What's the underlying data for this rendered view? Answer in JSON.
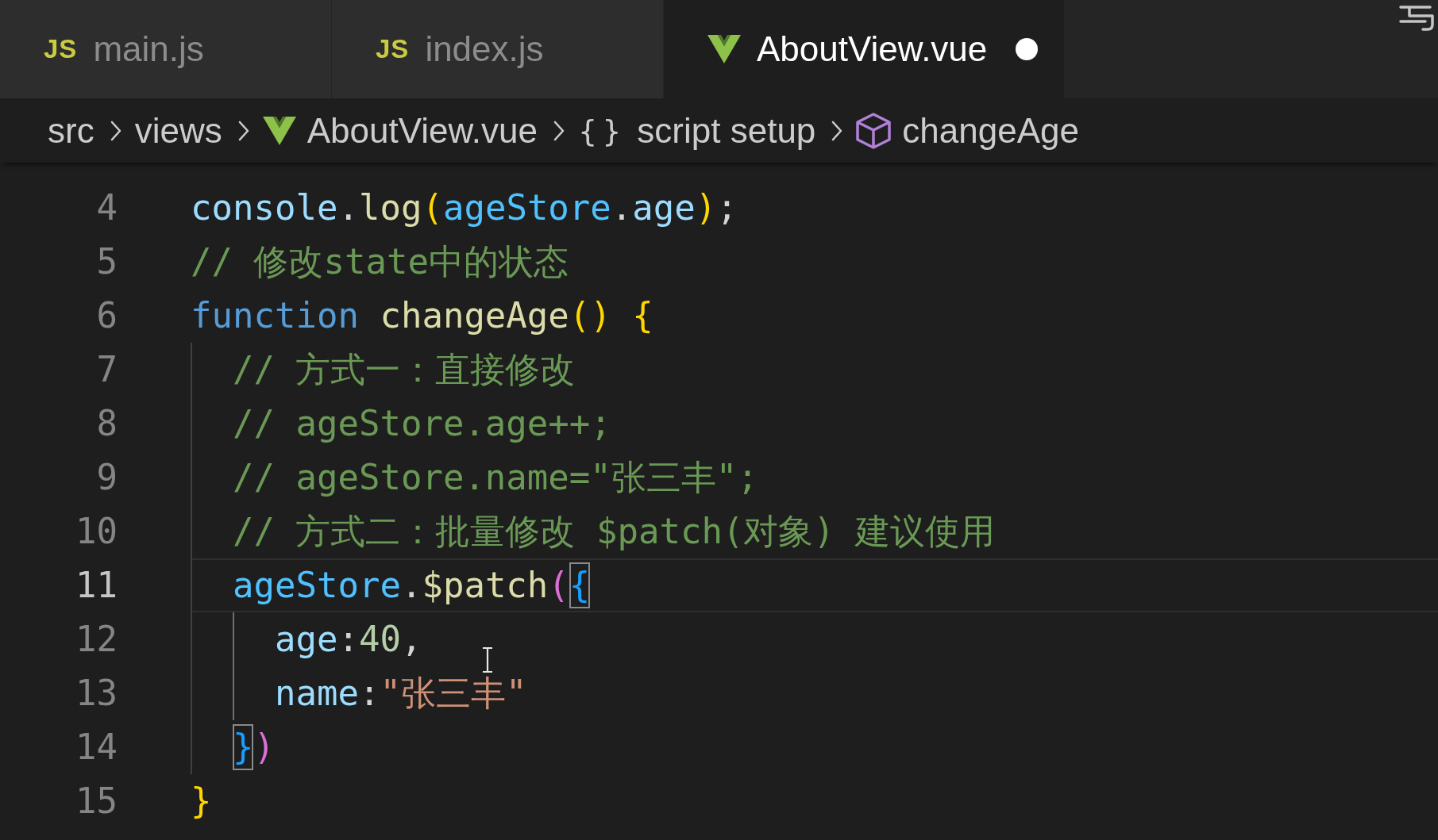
{
  "tabs": [
    {
      "kind": "js",
      "badge": "JS",
      "label": "main.js",
      "selected": false,
      "modified": false
    },
    {
      "kind": "js",
      "badge": "JS",
      "label": "index.js",
      "selected": false,
      "modified": false
    },
    {
      "kind": "vue",
      "label": "AboutView.vue",
      "selected": true,
      "modified": true
    }
  ],
  "breadcrumbs": [
    {
      "kind": "folder",
      "label": "src"
    },
    {
      "kind": "folder",
      "label": "views"
    },
    {
      "kind": "vue",
      "label": "AboutView.vue"
    },
    {
      "kind": "symbol",
      "glyph": "{}",
      "label": "script setup"
    },
    {
      "kind": "method",
      "label": "changeAge"
    }
  ],
  "editor": {
    "lines": [
      {
        "number": "4",
        "active": false,
        "tokens": [
          {
            "kind": "variable",
            "text": "console"
          },
          {
            "kind": "punct",
            "text": "."
          },
          {
            "kind": "function",
            "text": "log"
          },
          {
            "kind": "bracket",
            "text": "(",
            "color": "#ffd700",
            "matched": false
          },
          {
            "kind": "constant",
            "text": "ageStore"
          },
          {
            "kind": "punct",
            "text": "."
          },
          {
            "kind": "property",
            "text": "age"
          },
          {
            "kind": "bracket",
            "text": ")",
            "color": "#ffd700",
            "matched": false
          },
          {
            "kind": "punct",
            "text": ";"
          }
        ]
      },
      {
        "number": "5",
        "active": false,
        "tokens": [
          {
            "kind": "comment",
            "text": "// 修改state中的状态"
          }
        ]
      },
      {
        "number": "6",
        "active": false,
        "tokens": [
          {
            "kind": "keyword",
            "text": "function"
          },
          {
            "kind": "function",
            "text": " changeAge"
          },
          {
            "kind": "bracket",
            "text": "(",
            "color": "#ffd700",
            "matched": false
          },
          {
            "kind": "bracket",
            "text": ")",
            "color": "#ffd700",
            "matched": false
          },
          {
            "kind": "bracket",
            "text": " {",
            "color": "#ffd700",
            "matched": false
          }
        ]
      },
      {
        "number": "7",
        "active": false,
        "tokens": [
          {
            "kind": "comment",
            "text": "  // 方式一：直接修改"
          }
        ]
      },
      {
        "number": "8",
        "active": false,
        "tokens": [
          {
            "kind": "comment",
            "text": "  // ageStore.age++;"
          }
        ]
      },
      {
        "number": "9",
        "active": false,
        "tokens": [
          {
            "kind": "comment",
            "text": "  // ageStore.name=\"张三丰\";"
          }
        ]
      },
      {
        "number": "10",
        "active": false,
        "tokens": [
          {
            "kind": "comment",
            "text": "  // 方式二：批量修改 $patch(对象) 建议使用"
          }
        ]
      },
      {
        "number": "11",
        "active": true,
        "tokens": [
          {
            "kind": "constant",
            "text": "  ageStore"
          },
          {
            "kind": "punct",
            "text": "."
          },
          {
            "kind": "function",
            "text": "$patch"
          },
          {
            "kind": "bracket",
            "text": "(",
            "color": "#da70d6",
            "matched": false
          },
          {
            "kind": "bracket",
            "text": "{",
            "color": "#179fff",
            "matched": true
          }
        ]
      },
      {
        "number": "12",
        "active": false,
        "tokens": [
          {
            "kind": "property",
            "text": "    age"
          },
          {
            "kind": "punct",
            "text": ":"
          },
          {
            "kind": "number",
            "text": "40"
          },
          {
            "kind": "punct",
            "text": ","
          }
        ]
      },
      {
        "number": "13",
        "active": false,
        "tokens": [
          {
            "kind": "property",
            "text": "    name"
          },
          {
            "kind": "punct",
            "text": ":"
          },
          {
            "kind": "string",
            "text": "\"张三丰\""
          }
        ]
      },
      {
        "number": "14",
        "active": false,
        "tokens": [
          {
            "kind": "bracket",
            "text": "  }",
            "color": "#179fff",
            "matched": true
          },
          {
            "kind": "bracket",
            "text": ")",
            "color": "#da70d6",
            "matched": false
          }
        ]
      },
      {
        "number": "15",
        "active": false,
        "tokens": [
          {
            "kind": "bracket",
            "text": "}",
            "color": "#ffd700",
            "matched": false
          }
        ]
      }
    ]
  }
}
